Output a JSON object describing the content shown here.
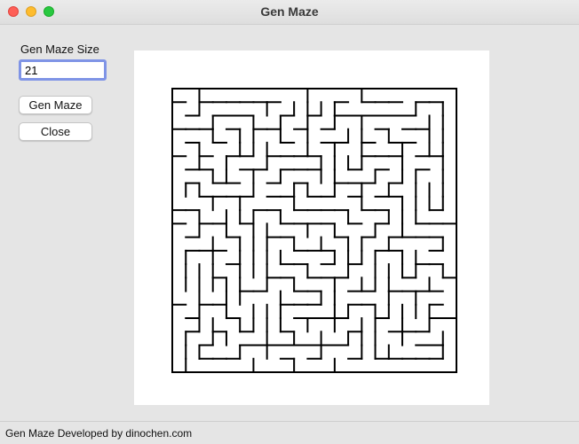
{
  "window": {
    "title": "Gen Maze"
  },
  "controls": {
    "size_label": "Gen Maze Size",
    "size_value": "21",
    "gen_button": "Gen Maze",
    "close_button": "Close"
  },
  "status": {
    "text": "Gen Maze Developed by dinochen.com"
  },
  "maze": {
    "size": 21
  },
  "colors": {
    "accent": "#7f94e6",
    "wall": "#000000",
    "canvas": "#ffffff"
  }
}
